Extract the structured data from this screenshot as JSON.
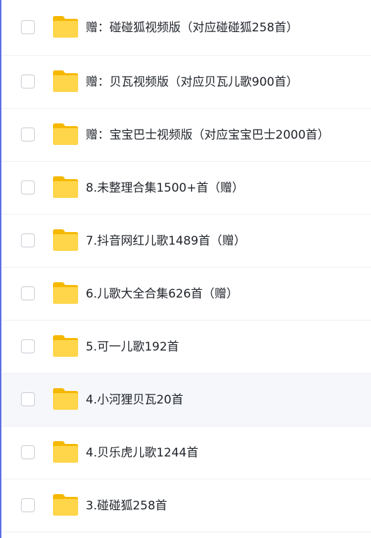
{
  "files": [
    {
      "name": "赠：碰碰狐视频版（对应碰碰狐258首）",
      "type": "folder"
    },
    {
      "name": "赠：贝瓦视频版（对应贝瓦儿歌900首）",
      "type": "folder"
    },
    {
      "name": "赠：宝宝巴士视频版（对应宝宝巴士2000首）",
      "type": "folder"
    },
    {
      "name": "8.未整理合集1500+首（赠）",
      "type": "folder"
    },
    {
      "name": "7.抖音网红儿歌1489首（赠）",
      "type": "folder"
    },
    {
      "name": "6.儿歌大全合集626首（赠）",
      "type": "folder"
    },
    {
      "name": "5.可一儿歌192首",
      "type": "folder"
    },
    {
      "name": "4.小河狸贝瓦20首",
      "type": "folder",
      "hovered": true
    },
    {
      "name": "4.贝乐虎儿歌1244首",
      "type": "folder"
    },
    {
      "name": "3.碰碰狐258首",
      "type": "folder"
    }
  ],
  "icons": {
    "folder": "folder-icon",
    "checkbox": "checkbox-unchecked"
  },
  "colors": {
    "folder_back": "#f5b800",
    "folder_front": "#ffd54a",
    "checkbox_border": "#c9ccd3",
    "hover_row": "#f5f7fb",
    "text": "#1f2329",
    "accent_rail": "#5b6ee1"
  }
}
